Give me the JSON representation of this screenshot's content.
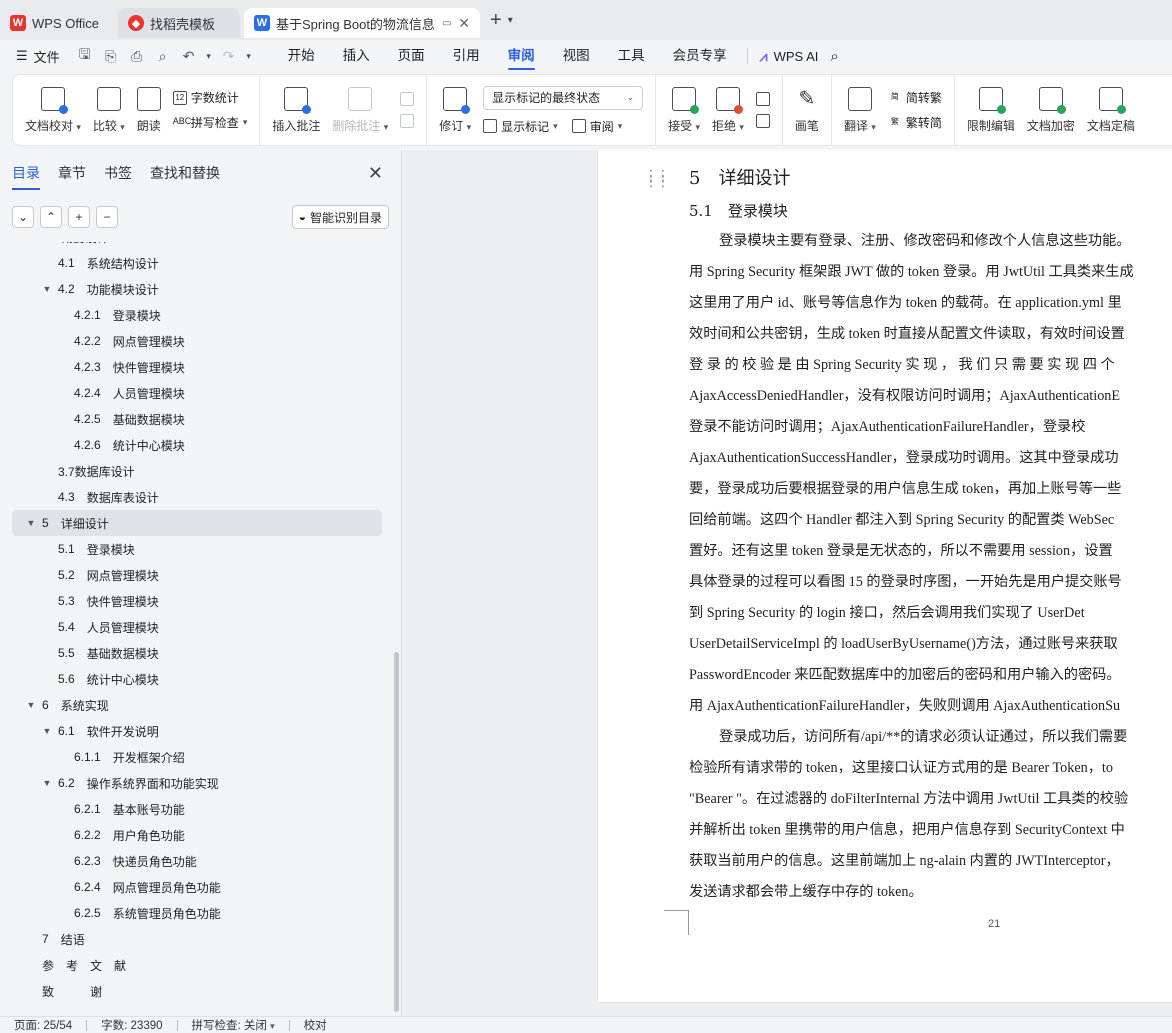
{
  "titlebar": {
    "tabs": [
      {
        "label": "WPS Office"
      },
      {
        "label": "找稻壳模板"
      },
      {
        "label": "基于Spring Boot的物流信息管理系统"
      }
    ]
  },
  "menubar": {
    "file_label": "文件",
    "items": [
      "开始",
      "插入",
      "页面",
      "引用",
      "审阅",
      "视图",
      "工具",
      "会员专享"
    ],
    "active": "审阅",
    "ai_label": "WPS AI"
  },
  "ribbon": {
    "doc_check": "文档校对",
    "compare": "比较",
    "read_aloud": "朗读",
    "word_count": "字数统计",
    "spell_check": "拼写检查",
    "insert_comment": "插入批注",
    "delete_comment": "删除批注",
    "track_changes": "修订",
    "markup_state": "显示标记的最终状态",
    "show_markup": "显示标记",
    "review": "审阅",
    "accept": "接受",
    "reject": "拒绝",
    "ink": "画笔",
    "translate": "翻译",
    "to_trad": "简转繁",
    "to_simp": "繁转简",
    "restrict_edit": "限制编辑",
    "encrypt": "文档加密",
    "finalize": "文档定稿"
  },
  "sidebar": {
    "tabs": [
      "目录",
      "章节",
      "书签",
      "查找和替换"
    ],
    "active_tab": "目录",
    "smart_toc": "智能识别目录",
    "toc": [
      {
        "num": "4",
        "title": "概要设计",
        "level": 1,
        "toggle": "▼"
      },
      {
        "num": "4.1",
        "title": "系统结构设计",
        "level": 2,
        "toggle": ""
      },
      {
        "num": "4.2",
        "title": "功能模块设计",
        "level": 2,
        "toggle": "▼"
      },
      {
        "num": "4.2.1",
        "title": "登录模块",
        "level": 3,
        "toggle": ""
      },
      {
        "num": "4.2.2",
        "title": "网点管理模块",
        "level": 3,
        "toggle": ""
      },
      {
        "num": "4.2.3",
        "title": "快件管理模块",
        "level": 3,
        "toggle": ""
      },
      {
        "num": "4.2.4",
        "title": "人员管理模块",
        "level": 3,
        "toggle": ""
      },
      {
        "num": "4.2.5",
        "title": "基础数据模块",
        "level": 3,
        "toggle": ""
      },
      {
        "num": "4.2.6",
        "title": "统计中心模块",
        "level": 3,
        "toggle": ""
      },
      {
        "num": "",
        "title": "3.7数据库设计",
        "level": 2,
        "toggle": ""
      },
      {
        "num": "4.3",
        "title": "数据库表设计",
        "level": 2,
        "toggle": ""
      },
      {
        "num": "5",
        "title": "详细设计",
        "level": 1,
        "toggle": "▼",
        "selected": true
      },
      {
        "num": "5.1",
        "title": "登录模块",
        "level": 2,
        "toggle": ""
      },
      {
        "num": "5.2",
        "title": "网点管理模块",
        "level": 2,
        "toggle": ""
      },
      {
        "num": "5.3",
        "title": "快件管理模块",
        "level": 2,
        "toggle": ""
      },
      {
        "num": "5.4",
        "title": "人员管理模块",
        "level": 2,
        "toggle": ""
      },
      {
        "num": "5.5",
        "title": "基础数据模块",
        "level": 2,
        "toggle": ""
      },
      {
        "num": "5.6",
        "title": "统计中心模块",
        "level": 2,
        "toggle": ""
      },
      {
        "num": "6",
        "title": "系统实现",
        "level": 1,
        "toggle": "▼"
      },
      {
        "num": "6.1",
        "title": "软件开发说明",
        "level": 2,
        "toggle": "▼"
      },
      {
        "num": "6.1.1",
        "title": "开发框架介绍",
        "level": 3,
        "toggle": ""
      },
      {
        "num": "6.2",
        "title": "操作系统界面和功能实现",
        "level": 2,
        "toggle": "▼"
      },
      {
        "num": "6.2.1",
        "title": "基本账号功能",
        "level": 3,
        "toggle": ""
      },
      {
        "num": "6.2.2",
        "title": "用户角色功能",
        "level": 3,
        "toggle": ""
      },
      {
        "num": "6.2.3",
        "title": "快递员角色功能",
        "level": 3,
        "toggle": ""
      },
      {
        "num": "6.2.4",
        "title": "网点管理员角色功能",
        "level": 3,
        "toggle": ""
      },
      {
        "num": "6.2.5",
        "title": "系统管理员角色功能",
        "level": 3,
        "toggle": ""
      },
      {
        "num": "7",
        "title": "结语",
        "level": 1,
        "toggle": ""
      },
      {
        "num": "",
        "title": "参　考　文　献",
        "level": 1,
        "toggle": ""
      },
      {
        "num": "",
        "title": "致　　　谢",
        "level": 1,
        "toggle": ""
      }
    ]
  },
  "document": {
    "heading1": "5　详细设计",
    "heading2": "5.1　登录模块",
    "lines": [
      {
        "text": "登录模块主要有登录、注册、修改密码和修改个人信息这些功能。",
        "indent": true
      },
      {
        "text": "用 Spring Security 框架跟 JWT 做的 token 登录。用 JwtUtil 工具类来生成",
        "indent": false
      },
      {
        "text": "这里用了用户 id、账号等信息作为 token 的载荷。在 application.yml 里",
        "indent": false
      },
      {
        "text": "效时间和公共密钥，生成 token 时直接从配置文件读取，有效时间设置",
        "indent": false
      },
      {
        "text": "登 录 的 校 验 是 由  Spring  Security  实 现 ， 我 们 只 需 要 实 现 四 个",
        "indent": false
      },
      {
        "text": "AjaxAccessDeniedHandler，没有权限访问时调用；AjaxAuthenticationE",
        "indent": false
      },
      {
        "text": "登录不能访问时调用；AjaxAuthenticationFailureHandler，登录校",
        "indent": false
      },
      {
        "text": "AjaxAuthenticationSuccessHandler，登录成功时调用。这其中登录成功",
        "indent": false
      },
      {
        "text": "要，登录成功后要根据登录的用户信息生成 token，再加上账号等一些",
        "indent": false
      },
      {
        "text": "回给前端。这四个 Handler 都注入到 Spring Security 的配置类 WebSec",
        "indent": false
      },
      {
        "text": "置好。还有这里 token 登录是无状态的，所以不需要用 session，设置",
        "indent": false
      },
      {
        "text": "具体登录的过程可以看图 15 的登录时序图，一开始先是用户提交账号",
        "indent": false
      },
      {
        "text": "到  Spring  Security  的  login  接口，然后会调用我们实现了  UserDet",
        "indent": false
      },
      {
        "text": "UserDetailServiceImpl 的 loadUserByUsername()方法，通过账号来获取",
        "indent": false
      },
      {
        "text": "PasswordEncoder 来匹配数据库中的加密后的密码和用户输入的密码。",
        "indent": false
      },
      {
        "text": "用 AjaxAuthenticationFailureHandler，失败则调用 AjaxAuthenticationSu",
        "indent": false
      },
      {
        "text": "登录成功后，访问所有/api/**的请求必须认证通过，所以我们需要",
        "indent": true
      },
      {
        "text": "检验所有请求带的 token，这里接口认证方式用的是 Bearer Token，to",
        "indent": false
      },
      {
        "text": "\"Bearer \"。在过滤器的 doFilterInternal 方法中调用 JwtUtil 工具类的校验",
        "indent": false
      },
      {
        "text": "并解析出 token 里携带的用户信息，把用户信息存到 SecurityContext 中",
        "indent": false
      },
      {
        "text": "获取当前用户的信息。这里前端加上 ng-alain 内置的 JWTInterceptor，",
        "indent": false
      },
      {
        "text": "发送请求都会带上缓存中存的 token。",
        "indent": false
      }
    ],
    "page_number": "21"
  },
  "statusbar": {
    "page": "页面: 25/54",
    "words": "字数: 23390",
    "spell": "拼写检查: 关闭",
    "proof": "校对"
  },
  "colors": {
    "accent": "#2b5fd9",
    "wps_red": "#e8342e",
    "doc_blue": "#2b6fe0"
  }
}
